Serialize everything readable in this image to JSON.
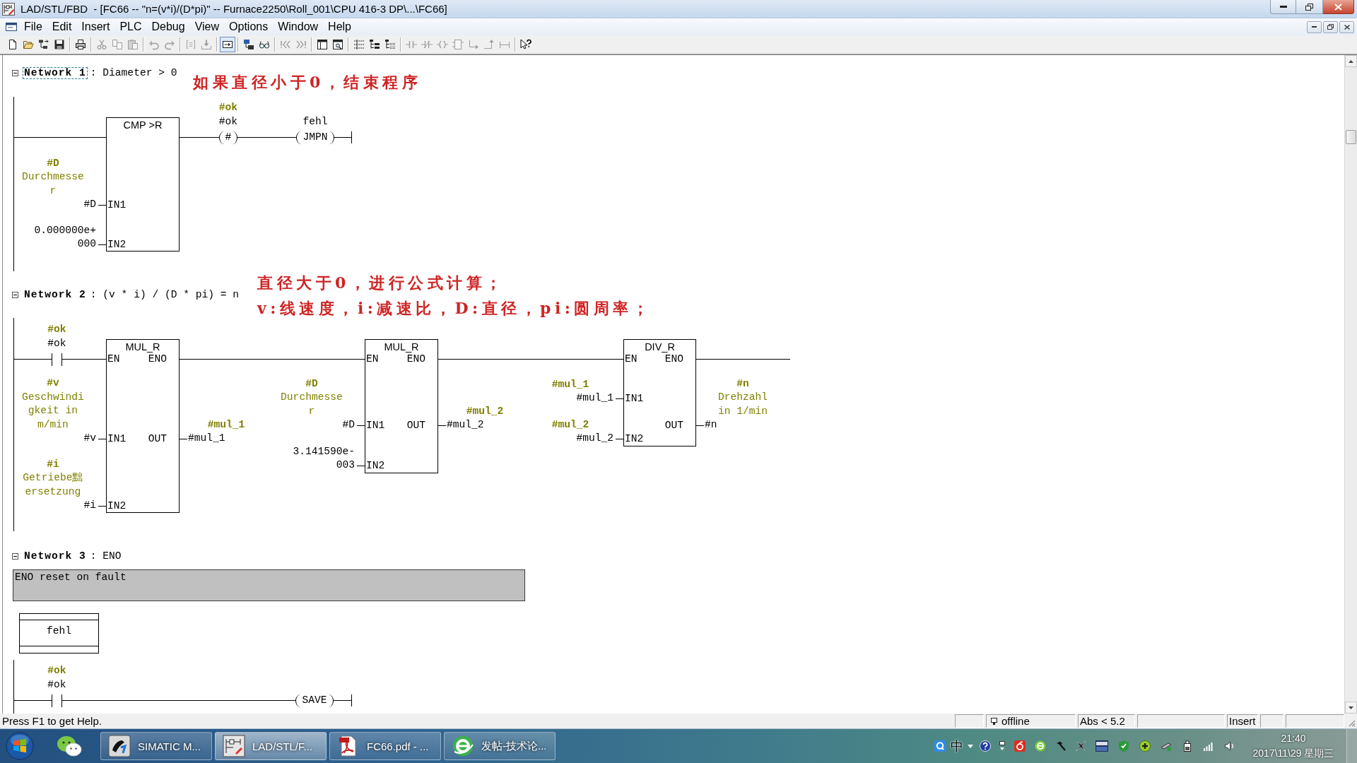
{
  "window": {
    "title": "LAD/STL/FBD  - [FC66 -- \"n=(v*i)/(D*pi)\" -- Furnace2250\\Roll_001\\CPU 416-3 DP\\...\\FC66]"
  },
  "menu": [
    {
      "label": "File"
    },
    {
      "label": "Edit"
    },
    {
      "label": "Insert"
    },
    {
      "label": "PLC"
    },
    {
      "label": "Debug"
    },
    {
      "label": "View"
    },
    {
      "label": "Options"
    },
    {
      "label": "Window"
    },
    {
      "label": "Help"
    }
  ],
  "toolbar": [
    [
      {
        "disabled": false,
        "pressed": false
      },
      {
        "disabled": false,
        "pressed": false
      },
      {
        "disabled": false,
        "pressed": false
      },
      {
        "disabled": false,
        "pressed": false
      }
    ],
    [
      {
        "disabled": false,
        "pressed": false
      }
    ],
    [
      {
        "disabled": true,
        "pressed": false
      },
      {
        "disabled": true,
        "pressed": false
      },
      {
        "disabled": true,
        "pressed": false
      }
    ],
    [
      {
        "disabled": true,
        "pressed": false
      },
      {
        "disabled": true,
        "pressed": false
      }
    ],
    [
      {
        "disabled": true,
        "pressed": false
      },
      {
        "disabled": true,
        "pressed": false
      }
    ],
    [
      {
        "disabled": false,
        "pressed": true
      }
    ],
    [
      {
        "disabled": false,
        "pressed": false
      },
      {
        "disabled": false,
        "pressed": false
      }
    ],
    [
      {
        "disabled": true,
        "pressed": false
      },
      {
        "disabled": true,
        "pressed": false
      }
    ],
    [
      {
        "disabled": false,
        "pressed": false
      },
      {
        "disabled": false,
        "pressed": false
      }
    ],
    [
      {
        "disabled": false,
        "pressed": false
      },
      {
        "disabled": false,
        "pressed": false
      },
      {
        "disabled": false,
        "pressed": false
      }
    ],
    [
      {
        "disabled": true,
        "pressed": false
      },
      {
        "disabled": true,
        "pressed": false
      },
      {
        "disabled": true,
        "pressed": false
      },
      {
        "disabled": true,
        "pressed": false
      },
      {
        "disabled": true,
        "pressed": false
      },
      {
        "disabled": true,
        "pressed": false
      },
      {
        "disabled": true,
        "pressed": false
      }
    ],
    [
      {
        "disabled": false,
        "pressed": false
      }
    ]
  ],
  "networks": [
    {
      "label": "Network 1",
      "title": ": Diameter > 0",
      "selected": true,
      "expanded": true,
      "annotation": [
        "如果直径小于0，结束程序"
      ],
      "rung": [
        {
          "kind": "block",
          "title": "CMP >R",
          "inputs": [
            {
              "pin": "IN1",
              "operand": "#D",
              "symbol": "#D",
              "comment": "Durchmesser"
            },
            {
              "pin": "IN2",
              "operand": "0.000000e+000"
            }
          ]
        },
        {
          "kind": "coil",
          "instruction": "#",
          "operand": "#ok",
          "symbol": "#ok"
        },
        {
          "kind": "coil",
          "instruction": "JMPN",
          "operand": "fehl"
        }
      ]
    },
    {
      "label": "Network 2",
      "title": ": (v * i) / (D * pi) = n",
      "selected": false,
      "expanded": true,
      "annotation": [
        "直径大于0，进行公式计算；",
        "v:线速度，i:减速比，D:直径，pi:圆周率；"
      ],
      "rung": [
        {
          "kind": "contact",
          "operand": "#ok",
          "symbol": "#ok"
        },
        {
          "kind": "block",
          "title": "MUL_R",
          "enable": {
            "in": "EN",
            "out": "ENO"
          },
          "inputs": [
            {
              "pin": "IN1",
              "operand": "#v",
              "symbol": "#v",
              "comment": "Geschwindigkeit in m/min"
            },
            {
              "pin": "IN2",
              "operand": "#i",
              "symbol": "#i",
              "comment": "Getriebe黜ersetzung"
            }
          ],
          "outputs": [
            {
              "pin": "OUT",
              "operand": "#mul_1",
              "symbol": "#mul_1"
            }
          ]
        },
        {
          "kind": "block",
          "title": "MUL_R",
          "enable": {
            "in": "EN",
            "out": "ENO"
          },
          "inputs": [
            {
              "pin": "IN1",
              "operand": "#D",
              "symbol": "#D",
              "comment": "Durchmesser"
            },
            {
              "pin": "IN2",
              "operand": "3.141590e-003"
            }
          ],
          "outputs": [
            {
              "pin": "OUT",
              "operand": "#mul_2",
              "symbol": "#mul_2"
            }
          ]
        },
        {
          "kind": "block",
          "title": "DIV_R",
          "enable": {
            "in": "EN",
            "out": "ENO"
          },
          "inputs": [
            {
              "pin": "IN1",
              "operand": "#mul_1",
              "symbol": "#mul_1"
            },
            {
              "pin": "IN2",
              "operand": "#mul_2",
              "symbol": "#mul_2"
            }
          ],
          "outputs": [
            {
              "pin": "OUT",
              "operand": "#n",
              "symbol": "#n",
              "comment": "Drehzahl in 1/min"
            }
          ]
        }
      ]
    },
    {
      "label": "Network 3",
      "title": ": ENO",
      "selected": false,
      "expanded": true,
      "comment": "ENO reset on fault",
      "jump_label": "fehl",
      "rung": [
        {
          "kind": "contact",
          "operand": "#ok",
          "symbol": "#ok"
        },
        {
          "kind": "coil",
          "instruction": "SAVE"
        }
      ]
    }
  ],
  "status_bar": {
    "message": "Press F1 to get Help.",
    "connection": "offline",
    "position": "Abs < 5.2",
    "mode": "Insert"
  },
  "taskbar": {
    "buttons": [
      {
        "label": "SIMATIC M...",
        "selected": false
      },
      {
        "label": "LAD/STL/F...",
        "selected": true
      },
      {
        "label": "FC66.pdf - ...",
        "selected": false
      },
      {
        "label": "发帖-技术论...",
        "selected": false
      }
    ],
    "ime": "中",
    "time": "21:40",
    "date": "2017\\11\\29 星期三"
  }
}
